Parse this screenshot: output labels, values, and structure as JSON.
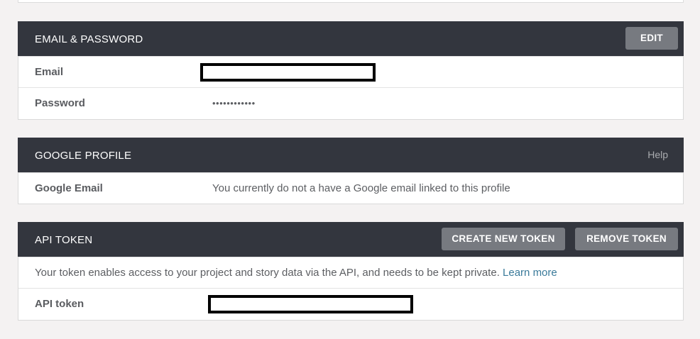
{
  "email_password": {
    "title": "EMAIL & PASSWORD",
    "edit_label": "EDIT",
    "email_label": "Email",
    "password_label": "Password",
    "password_value": "••••••••••••"
  },
  "google_profile": {
    "title": "GOOGLE PROFILE",
    "help_label": "Help",
    "google_email_label": "Google Email",
    "google_email_value": "You currently do not a have a Google email linked to this profile"
  },
  "api_token": {
    "title": "API TOKEN",
    "create_label": "CREATE NEW TOKEN",
    "remove_label": "REMOVE TOKEN",
    "info_text": "Your token enables access to your project and story data via the API, and needs to be kept private. ",
    "learn_more_label": "Learn more",
    "token_label": "API token"
  }
}
